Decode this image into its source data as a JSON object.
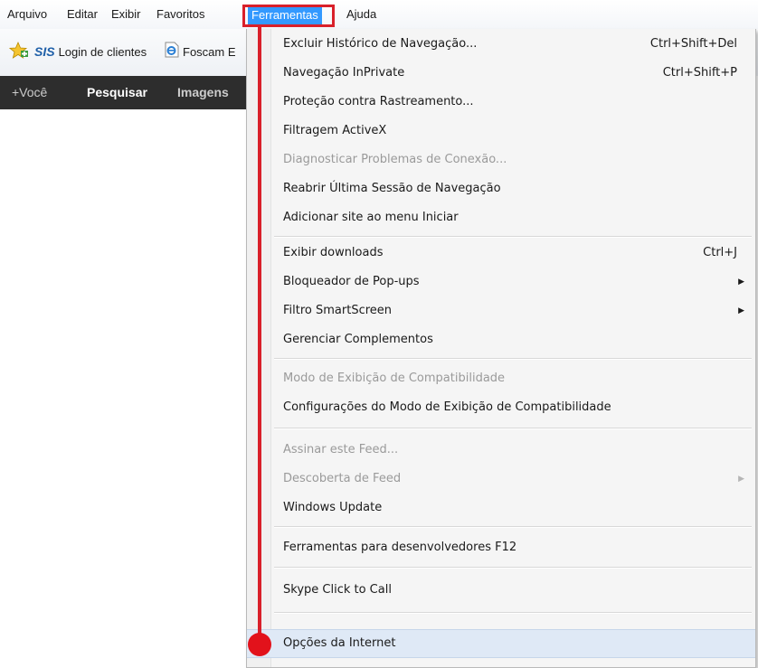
{
  "menubar": {
    "items": [
      "Arquivo",
      "Editar",
      "Exibir",
      "Favoritos",
      "Ferramentas",
      "Ajuda"
    ],
    "active": "Ferramentas"
  },
  "favorites_bar": {
    "items": [
      {
        "label": "Login de clientes",
        "icon": "sis-icon",
        "icon_text": "SIS"
      },
      {
        "label": "Foscam E",
        "icon": "ie-page-icon"
      }
    ],
    "favorites_icon": "favorites-star-icon"
  },
  "google_bar": {
    "items": [
      "+Você",
      "Pesquisar",
      "Imagens"
    ]
  },
  "tools_menu": {
    "groups": [
      [
        {
          "label": "Excluir Histórico de Navegação...",
          "shortcut": "Ctrl+Shift+Del",
          "enabled": true
        },
        {
          "label": "Navegação InPrivate",
          "shortcut": "Ctrl+Shift+P",
          "enabled": true
        },
        {
          "label": "Proteção contra Rastreamento...",
          "enabled": true
        },
        {
          "label": "Filtragem ActiveX",
          "enabled": true
        },
        {
          "label": "Diagnosticar Problemas de Conexão...",
          "enabled": false
        },
        {
          "label": "Reabrir Última Sessão de Navegação",
          "enabled": true
        },
        {
          "label": "Adicionar site ao menu Iniciar",
          "enabled": true
        }
      ],
      [
        {
          "label": "Exibir downloads",
          "shortcut": "Ctrl+J",
          "enabled": true
        },
        {
          "label": "Bloqueador de Pop-ups",
          "submenu": true,
          "enabled": true
        },
        {
          "label": "Filtro SmartScreen",
          "submenu": true,
          "enabled": true
        },
        {
          "label": "Gerenciar Complementos",
          "enabled": true
        }
      ],
      [
        {
          "label": "Modo de Exibição de Compatibilidade",
          "enabled": false
        },
        {
          "label": "Configurações do Modo de Exibição de Compatibilidade",
          "enabled": true
        }
      ],
      [
        {
          "label": "Assinar este Feed...",
          "enabled": false
        },
        {
          "label": "Descoberta de Feed",
          "submenu": true,
          "enabled": false
        },
        {
          "label": "Windows Update",
          "enabled": true
        }
      ],
      [
        {
          "label": "Ferramentas para desenvolvedores F12",
          "enabled": true
        }
      ],
      [
        {
          "label": "Skype Click to Call",
          "enabled": true
        }
      ],
      [
        {
          "label": "Opções da Internet",
          "enabled": true,
          "highlighted": true
        }
      ]
    ]
  },
  "colors": {
    "menu_highlight": "#3399ff",
    "annotation_red": "#d9202a",
    "disabled_text": "#9a9a9a"
  }
}
